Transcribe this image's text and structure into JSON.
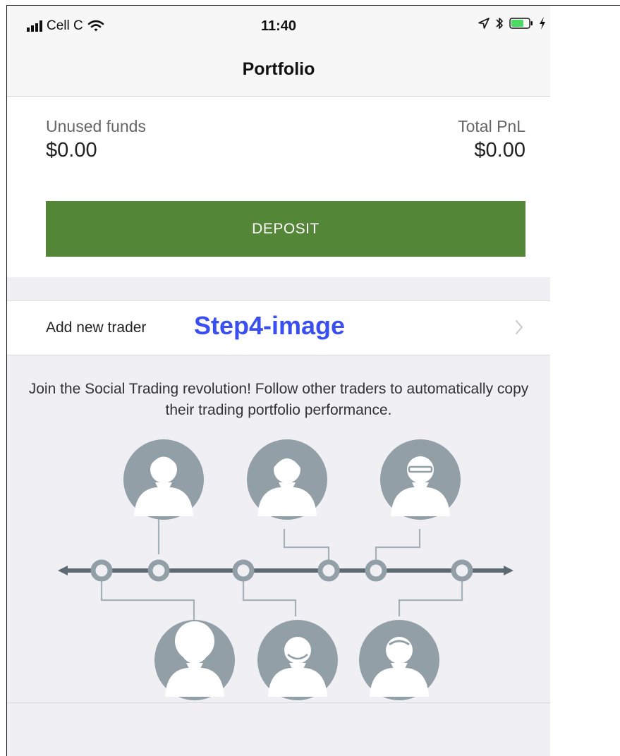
{
  "status_bar": {
    "carrier": "Cell C",
    "time": "11:40"
  },
  "nav": {
    "title": "Portfolio"
  },
  "funds": {
    "unused_label": "Unused funds",
    "unused_value": "$0.00",
    "pnl_label": "Total PnL",
    "pnl_value": "$0.00"
  },
  "deposit_label": "DEPOSIT",
  "add_trader": {
    "label": "Add new trader",
    "overlay_text": "Step4-image"
  },
  "promo": {
    "text": "Join the Social Trading revolution! Follow other traders to automatically copy their trading portfolio performance."
  },
  "colors": {
    "deposit_green": "#548638",
    "overlay_blue": "#3b4ff0",
    "avatar_circle": "#929fa7",
    "timeline": "#5d6a72",
    "background_gray": "#efeff4"
  },
  "icons": [
    "signal-bars-icon",
    "wifi-icon",
    "location-arrow-icon",
    "bluetooth-icon",
    "battery-icon",
    "charging-bolt-icon",
    "chevron-right-icon",
    "person-avatar-icon"
  ]
}
